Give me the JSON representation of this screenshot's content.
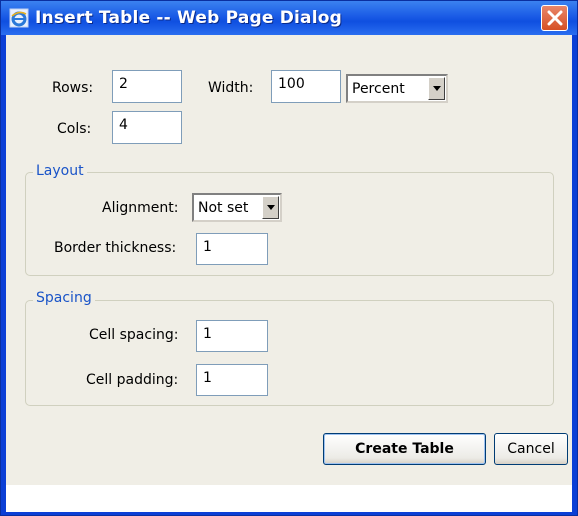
{
  "window": {
    "title": "Insert Table -- Web Page Dialog"
  },
  "fields": {
    "rows": {
      "label": "Rows:",
      "value": "2"
    },
    "cols": {
      "label": "Cols:",
      "value": "4"
    },
    "width": {
      "label": "Width:",
      "value": "100",
      "unit": "Percent"
    }
  },
  "layout": {
    "legend": "Layout",
    "alignment": {
      "label": "Alignment:",
      "value": "Not set"
    },
    "border": {
      "label": "Border thickness:",
      "value": "1"
    }
  },
  "spacing": {
    "legend": "Spacing",
    "cell_spacing": {
      "label": "Cell spacing:",
      "value": "1"
    },
    "cell_padding": {
      "label": "Cell padding:",
      "value": "1"
    }
  },
  "buttons": {
    "create": "Create Table",
    "cancel": "Cancel"
  },
  "colors": {
    "titlebar": "#1a5be6",
    "dialog_bg": "#f0eee6",
    "legend_text": "#1a54c8",
    "close_button": "#d64f24"
  },
  "icons": {
    "window": "ie-icon",
    "close": "close-icon"
  }
}
